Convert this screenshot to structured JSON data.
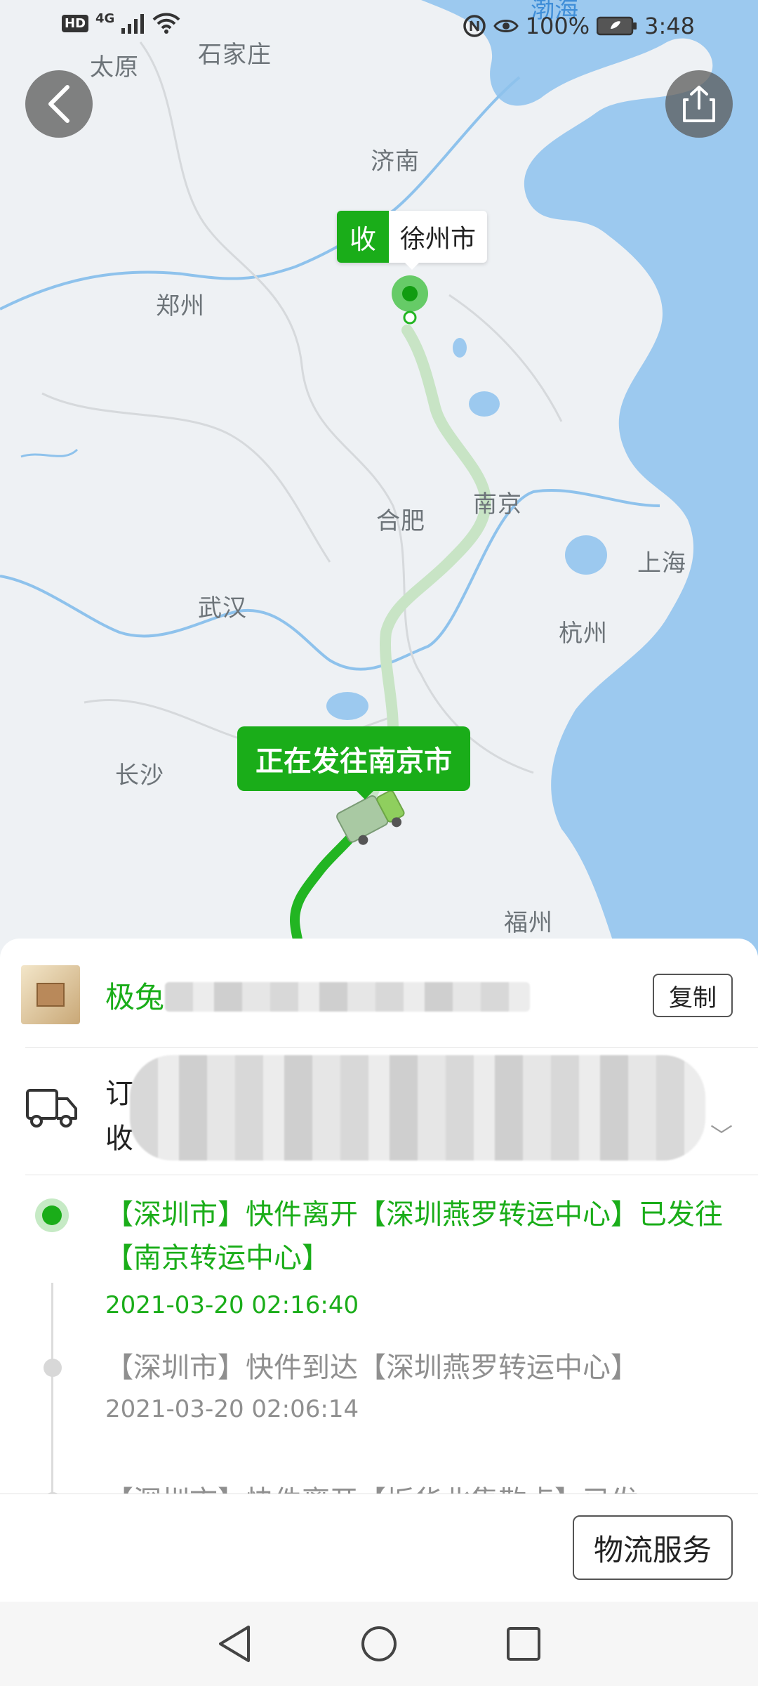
{
  "status_bar": {
    "hd": "HD",
    "network": "4G",
    "battery": "100%",
    "time": "3:48"
  },
  "map": {
    "cities": [
      {
        "name": "太原"
      },
      {
        "name": "石家庄"
      },
      {
        "name": "济南"
      },
      {
        "name": "郑州"
      },
      {
        "name": "合肥"
      },
      {
        "name": "南京"
      },
      {
        "name": "上海"
      },
      {
        "name": "武汉"
      },
      {
        "name": "杭州"
      },
      {
        "name": "长沙"
      },
      {
        "name": "福州"
      }
    ],
    "sea": "渤海",
    "receiver_badge": "收",
    "receiver_city": "徐州市",
    "status_bubble": "正在发往南京市"
  },
  "courier": {
    "name": "极兔",
    "copy_label": "复制"
  },
  "order": {
    "line1": "订单",
    "line2": "收"
  },
  "timeline": [
    {
      "text": "【深圳市】快件离开【深圳燕罗转运中心】已发往【南京转运中心】",
      "time": "2021-03-20 02:16:40",
      "active": true
    },
    {
      "text": "【深圳市】快件到达【深圳燕罗转运中心】",
      "time": "2021-03-20 02:06:14",
      "active": false
    },
    {
      "text": "【深圳市】快件离开【坂华北集散点】已发",
      "time": "",
      "active": false
    }
  ],
  "actions": {
    "service_label": "物流服务"
  },
  "colors": {
    "accent": "#1aad19",
    "sea": "#9cc9ef"
  }
}
